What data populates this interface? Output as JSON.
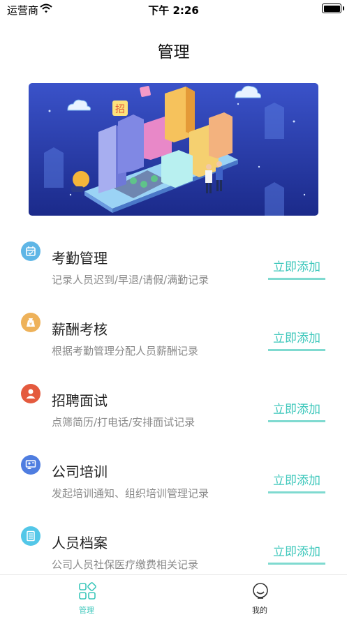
{
  "status_bar": {
    "carrier": "运营商",
    "time": "下午 2:26"
  },
  "header": {
    "title": "管理"
  },
  "banner": {
    "sign_text": "招"
  },
  "items": [
    {
      "title": "考勤管理",
      "desc": "记录人员迟到/早退/请假/满勤记录",
      "action": "立即添加",
      "icon": "calendar-icon",
      "color": "#5fb6e6"
    },
    {
      "title": "薪酬考核",
      "desc": "根据考勤管理分配人员薪酬记录",
      "action": "立即添加",
      "icon": "money-bag-icon",
      "color": "#eeb25a"
    },
    {
      "title": "招聘面试",
      "desc": "点筛简历/打电话/安排面试记录",
      "action": "立即添加",
      "icon": "person-icon",
      "color": "#e45a3e"
    },
    {
      "title": "公司培训",
      "desc": "发起培训通知、组织培训管理记录",
      "action": "立即添加",
      "icon": "training-icon",
      "color": "#4f7de0"
    },
    {
      "title": "人员档案",
      "desc": "公司人员社保医疗缴费相关记录",
      "action": "立即添加",
      "icon": "file-icon",
      "color": "#53c7e8"
    }
  ],
  "tab_bar": {
    "tabs": [
      {
        "label": "管理",
        "icon": "grid-icon",
        "active": true
      },
      {
        "label": "我的",
        "icon": "smile-icon",
        "active": false
      }
    ],
    "active_color": "#3cc7bb",
    "inactive_color": "#333333"
  }
}
